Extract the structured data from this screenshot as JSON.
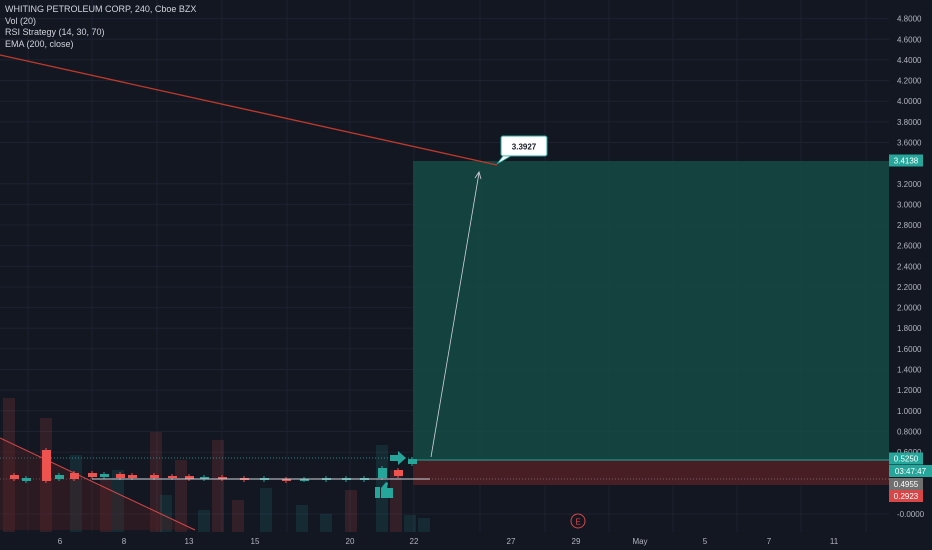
{
  "legend": {
    "symbol_line": "WHITING PETROLEUM CORP, 240, Cboe BZX",
    "volume": "Vol (20)",
    "strategy": "RSI Strategy (14, 30, 70)",
    "ema": "EMA (200, close)"
  },
  "price_axis": {
    "labels": [
      "4.8000",
      "4.6000",
      "4.4000",
      "4.2000",
      "4.0000",
      "3.8000",
      "3.6000",
      "3.2000",
      "3.0000",
      "2.8000",
      "2.6000",
      "2.4000",
      "2.2000",
      "2.0000",
      "1.8000",
      "1.6000",
      "1.4000",
      "1.2000",
      "1.0000",
      "0.8000",
      "0.6000",
      "-0.0000"
    ],
    "values": [
      4.8,
      4.6,
      4.4,
      4.2,
      4.0,
      3.8,
      3.6,
      3.2,
      3.0,
      2.8,
      2.6,
      2.4,
      2.2,
      2.0,
      1.8,
      1.6,
      1.4,
      1.2,
      1.0,
      0.8,
      0.6,
      0.0
    ]
  },
  "time_axis": {
    "labels": [
      "6",
      "8",
      "13",
      "15",
      "20",
      "22",
      "27",
      "29",
      "May",
      "5",
      "7",
      "11"
    ]
  },
  "price_tags": {
    "target": "3.4138",
    "entry": "0.5250",
    "countdown": "03:47:47",
    "last": "0.4955",
    "stop": "0.2923"
  },
  "callout": "3.3927",
  "earnings_marker": "E",
  "colors": {
    "background": "#131722",
    "target_zone": "#144a44",
    "stop_zone": "#4a1f24",
    "ema_line": "#c0392b",
    "bull": "#26a69a",
    "bear": "#ef5350",
    "tag_green": "#26a69a",
    "tag_gray": "#707070",
    "tag_red": "#d84747"
  },
  "icons": [
    "arrow-right-icon",
    "thumbs-up-icon",
    "earnings-icon"
  ]
}
